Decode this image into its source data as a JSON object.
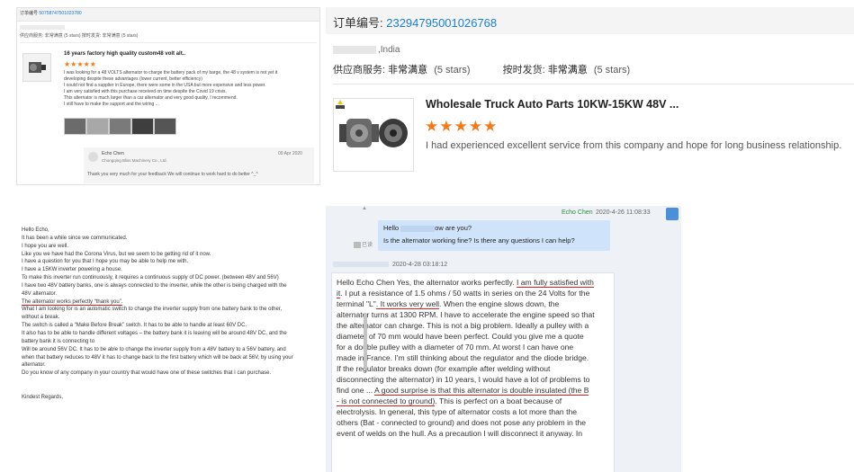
{
  "review_card": {
    "order_label": "订单编号",
    "order_no": "50758747501023780",
    "ratings": "供应商服务: 非常满意 (5 stars)    按时发货: 非常满意 (5 stars)",
    "product_title": "16 years factory high quality custom48 volt alt..",
    "stars": "★★★★★",
    "review_lines": [
      "I was looking for a 48 VOLTS alternator to charge the battery pack of my barge, the 48 v system is not yet it",
      "developing despite these advantages (lower current, better efficiency)",
      "I could not find a supplier in Europe, there were some in the USA but more expensive and less power.",
      "I am very satisfied with this purchase received on time despite the Covid 19 crisis.",
      "This alternator is much larger than a car alternator and very good quality, I recommend.",
      "I still have to make the support and the wiring ..."
    ],
    "replier": "Echo Chen",
    "replier_company": "Chongqing Bliss Machinery Co., Ltd.",
    "reply_date": "09 Apr 2020",
    "reply_text": "Thank you very much for your feedback We will continue to work hard to do better ^_^"
  },
  "order_panel": {
    "order_label": "订单编号: ",
    "order_no": "23294795001026768",
    "location": ",India",
    "supplier_service_label": "供应商服务: ",
    "supplier_service_value": "非常满意",
    "supplier_service_stars": "(5 stars)",
    "delivery_label": "按时发货: ",
    "delivery_value": "非常满意",
    "delivery_stars": "(5 stars)",
    "product_title": "Wholesale Truck Auto Parts 10KW-15KW 48V ...",
    "stars": "★★★★★",
    "review": "I had experienced excellent service from this company and hope for long business relationship."
  },
  "email": {
    "lines": [
      "Hello Echo,",
      "It has been a while since we communicated.",
      "I hope you are well.",
      "Like you we have had the Corona Virus, but we seem to be getting rid of it now.",
      "I have a question for you that I hope you may be able to help me with.",
      "I have a 15KW inverter powering a house.",
      "To make this inverter run continuously, it requires a continuous supply of DC power. (between 48V and 56V)",
      "I have two 48V battery banks, one is always connected to the inverter, while the other is being charged with the",
      "48V alternator.",
      "The alternator works perfectly “thank you”.",
      "What I am looking for is an automatic switch to change the inverter supply from one battery bank to the other,",
      "without a break.",
      "The switch is called a “Make Before Break” switch. It has to be able to handle at least 60V DC.",
      "It also has to be able to handle different voltages – the battery bank it is leaving will be around 48V DC, and the",
      "battery bank it is connecting to",
      "Will be around 56V DC. It has to be able to change the inverter supply from a 48V battery to a 56V battery, and",
      "when that battery reduces to 48V it has to change back to the first battery which will be back at 56V, by using your",
      "alternator.",
      "Do you know of any company in your country that would have one of these switches that I can purchase.",
      "",
      "",
      "Kindest Regards,"
    ]
  },
  "chat": {
    "sender": "Echo Chen",
    "sent_time": "2020-4-26 11:08:33",
    "out_line1_a": "Hello",
    "out_line1_b": "ow are you?",
    "out_line2": "Is the alternator working fine? Is there any questions I can help?",
    "read_status": "已读",
    "in_time": "2020-4-28 03:18:12",
    "in_lines": [
      [
        "Hello Echo Chen Yes, the alternator works perfectly. ",
        "I am fully satisfied with"
      ],
      [
        "it",
        ". I put a resistance of 1.5 ohms / 50 watts in series on the 24 Volts for the"
      ],
      [
        "terminal \"L\"",
        ". It works very well",
        ". When the engine slows down, the"
      ],
      [
        "alternator turns at 1300 RPM. I have to accelerate the engine speed so that"
      ],
      [
        "the alternator can charge. This is not a big problem. Ideally a pulley with a"
      ],
      [
        "diameter of 70 mm would have been perfect. Could you give me a quote"
      ],
      [
        "for a double pulley with a diameter of 70 mm. At worst I can have one"
      ],
      [
        "made in France. I'm still thinking about the regulator and the diode bridge."
      ],
      [
        "If the regulator breaks down (for example after welding without"
      ],
      [
        "disconnecting the alternator) in 10 years, I would have a lot of problems to"
      ],
      [
        "find one ... ",
        "A good surprise is that this alternator is double insulated (the B"
      ],
      [
        "- is not connected to ground)",
        ". This is perfect on a boat because of"
      ],
      [
        "electrolysis. In general, this type of alternator costs a lot more than the"
      ],
      [
        "others (Bat - connected to ground) and does not pose any problem in the"
      ],
      [
        "event of welds on the hull. As a precaution I will disconnect it anyway. In"
      ]
    ]
  },
  "colors": {
    "accent_blue": "#1a7fd4",
    "star_orange": "#f27a1a",
    "underline_red": "#d81e1e",
    "chat_bg": "#eef1f6",
    "bubble_out": "#cfe4fb",
    "sender_green": "#2f8a3c"
  }
}
